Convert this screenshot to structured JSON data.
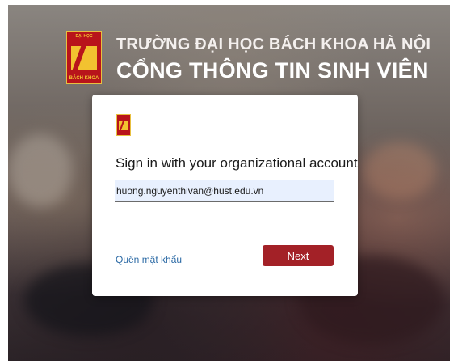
{
  "header": {
    "school_name": "TRƯỜNG ĐẠI HỌC BÁCH KHOA HÀ NỘI",
    "portal_name": "CỔNG THÔNG TIN SINH VIÊN",
    "logo_top_text": "ĐẠI HỌC",
    "logo_bottom_text": "BÁCH KHOA"
  },
  "signin": {
    "title": "Sign in with your organizational account",
    "email_value": "huong.nguyenthivan@hust.edu.vn",
    "forgot_password_label": "Quên mật khẩu",
    "next_label": "Next"
  },
  "colors": {
    "brand_red": "#a32127",
    "brand_gold": "#f2c230",
    "link_blue": "#2c6aa5",
    "input_bg": "#e8f0fe"
  }
}
